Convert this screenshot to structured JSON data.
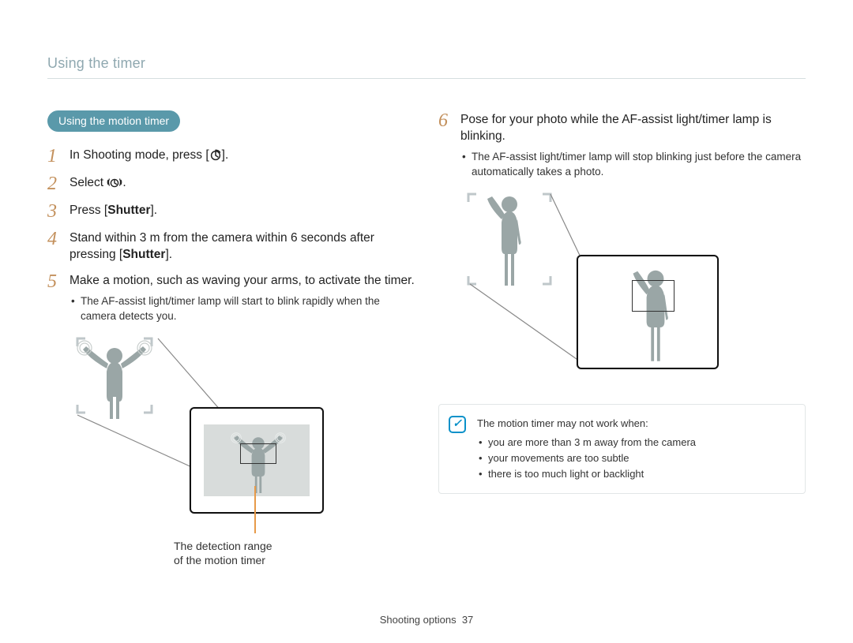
{
  "breadcrumb": "Using the timer",
  "pill": "Using the motion timer",
  "steps": {
    "s1": {
      "num": "1",
      "pre": "In Shooting mode, press [",
      "post": "]."
    },
    "s2": {
      "num": "2",
      "pre": "Select ",
      "post": "."
    },
    "s3": {
      "num": "3",
      "pre": "Press [",
      "bold": "Shutter",
      "post": "]."
    },
    "s4": {
      "num": "4",
      "pre": "Stand within 3 m from the camera within 6 seconds after pressing [",
      "bold": "Shutter",
      "post": "]."
    },
    "s5": {
      "num": "5",
      "text": "Make a motion, such as waving your arms, to activate the timer.",
      "sub": "The AF-assist light/timer lamp will start to blink rapidly when the camera detects you."
    },
    "s6": {
      "num": "6",
      "text": "Pose for your photo while the AF-assist light/timer lamp is blinking.",
      "sub": "The AF-assist light/timer lamp will stop blinking just before the camera automatically takes a photo."
    }
  },
  "caption1_line1": "The detection range",
  "caption1_line2": "of the motion timer",
  "notebox": {
    "intro": "The motion timer may not work when:",
    "items": [
      "you are more than 3 m away from the camera",
      "your movements are too subtle",
      "there is too much light or backlight"
    ]
  },
  "footer_label": "Shooting options",
  "footer_page": "37"
}
